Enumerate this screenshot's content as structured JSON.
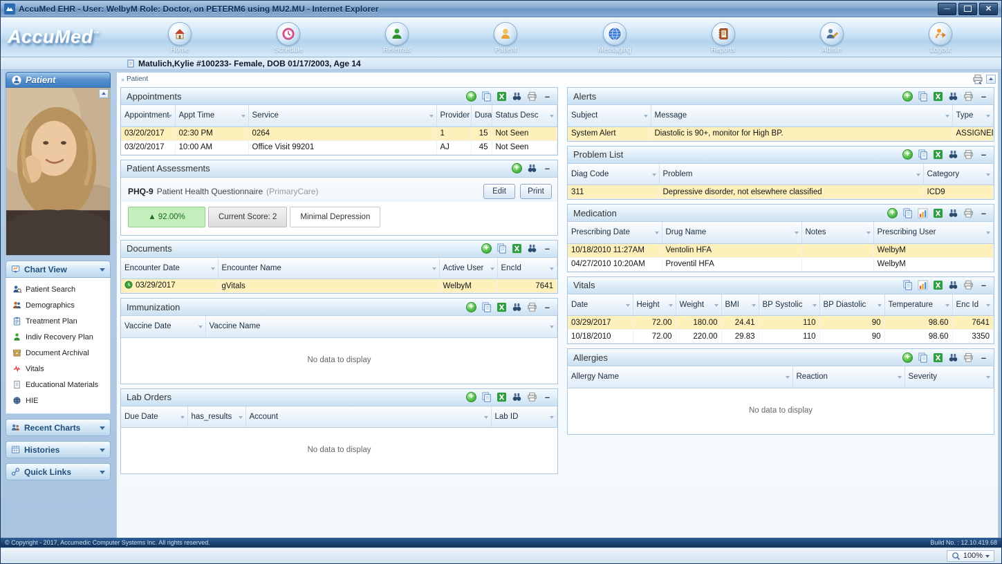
{
  "window": {
    "title": "AccuMed EHR - User: WelbyM Role: Doctor, on PETERM6 using MU2.MU - Internet Explorer"
  },
  "nav": {
    "brand": "AccuMed",
    "brand_tm": "™",
    "labels": [
      "Home",
      "Schedule",
      "Referrals",
      "Patient",
      "Messaging",
      "Reports",
      "Admin",
      "Logout"
    ]
  },
  "banner": {
    "patient_info": "Matulich,Kylie #100233- Female, DOB 01/17/2003, Age 14"
  },
  "breadcrumb": {
    "label": "Patient"
  },
  "sidebar": {
    "title": "Patient",
    "chart_view_label": "Chart View",
    "chart_view_items": [
      "Patient Search",
      "Demographics",
      "Treatment Plan",
      "Indiv Recovery Plan",
      "Document Archival",
      "Vitals",
      "Educational Materials",
      "HIE"
    ],
    "sections": [
      "Recent Charts",
      "Histories",
      "Quick Links"
    ]
  },
  "panels": {
    "appointments": {
      "title": "Appointments",
      "columns": [
        "Appointment",
        "Appt Time",
        "Service",
        "Provider",
        "Dura",
        "Status Desc"
      ],
      "rows": [
        [
          "03/20/2017",
          "02:30 PM",
          "0264",
          "1",
          "15",
          "Not Seen"
        ],
        [
          "03/20/2017",
          "10:00 AM",
          "Office Visit 99201",
          "AJ",
          "45",
          "Not Seen"
        ]
      ]
    },
    "assessments": {
      "title": "Patient Assessments",
      "tool_name": "PHQ-9",
      "tool_desc": "Patient Health Questionnaire",
      "tool_source": "(PrimaryCare)",
      "edit_label": "Edit",
      "print_label": "Print",
      "score_percent": "▲ 92.00%",
      "current_score": "Current Score: 2",
      "severity": "Minimal Depression"
    },
    "documents": {
      "title": "Documents",
      "columns": [
        "Encounter Date",
        "Encounter Name",
        "Active User",
        "EncId"
      ],
      "rows": [
        [
          "03/29/2017",
          "gVitals",
          "WelbyM",
          "7641"
        ]
      ]
    },
    "immunization": {
      "title": "Immunization",
      "columns": [
        "Vaccine Date",
        "Vaccine Name"
      ],
      "empty_message": "No data to display"
    },
    "lab_orders": {
      "title": "Lab Orders",
      "columns": [
        "Due Date",
        "has_results",
        "Account",
        "Lab ID"
      ],
      "empty_message": "No data to display"
    },
    "alerts": {
      "title": "Alerts",
      "columns": [
        "Subject",
        "Message",
        "Type"
      ],
      "rows": [
        [
          "System Alert",
          "Diastolic is 90+, monitor for High BP.",
          "ASSIGNED"
        ]
      ]
    },
    "problem_list": {
      "title": "Problem List",
      "columns": [
        "Diag Code",
        "Problem",
        "Category"
      ],
      "rows": [
        [
          "311",
          "Depressive disorder, not elsewhere classified",
          "ICD9"
        ]
      ]
    },
    "medication": {
      "title": "Medication",
      "columns": [
        "Prescribing Date",
        "Drug Name",
        "Notes",
        "Prescribing User"
      ],
      "rows": [
        [
          "10/18/2010 11:27AM",
          "Ventolin HFA",
          "",
          "WelbyM"
        ],
        [
          "04/27/2010 10:20AM",
          "Proventil HFA",
          "",
          "WelbyM"
        ]
      ]
    },
    "vitals": {
      "title": "Vitals",
      "columns": [
        "Date",
        "Height",
        "Weight",
        "BMI",
        "BP Systolic",
        "BP Diastolic",
        "Temperature",
        "Enc Id"
      ],
      "rows": [
        [
          "03/29/2017",
          "72.00",
          "180.00",
          "24.41",
          "110",
          "90",
          "98.60",
          "7641"
        ],
        [
          "10/18/2010",
          "72.00",
          "220.00",
          "29.83",
          "110",
          "90",
          "98.60",
          "3350"
        ]
      ]
    },
    "allergies": {
      "title": "Allergies",
      "columns": [
        "Allergy Name",
        "Reaction",
        "Severity"
      ],
      "empty_message": "No data to display"
    }
  },
  "footer": {
    "copyright": "© Copyright - 2017, Accumedic Computer Systems Inc. All rights reserved.",
    "build": "Build No. : 12.10.419.68"
  },
  "statusbar": {
    "zoom": "100%"
  }
}
